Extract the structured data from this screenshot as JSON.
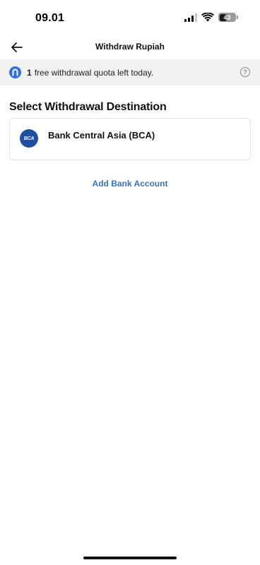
{
  "status_bar": {
    "time": "09.01",
    "battery_level": "43"
  },
  "header": {
    "title": "Withdraw Rupiah"
  },
  "quota_banner": {
    "count": "1",
    "text": "free withdrawal quota left today."
  },
  "section": {
    "title": "Select Withdrawal Destination"
  },
  "bank": {
    "logo_text": "BCA",
    "name": "Bank Central Asia (BCA)"
  },
  "add_bank": {
    "label": "Add Bank Account"
  },
  "colors": {
    "accent": "#3a6fc4",
    "bank_logo": "#1f4fa3",
    "banner_bg": "#f1f1f1"
  },
  "icons": [
    "back-arrow-icon",
    "help-icon",
    "app-logo-icon",
    "signal-icon",
    "wifi-icon",
    "battery-icon"
  ]
}
